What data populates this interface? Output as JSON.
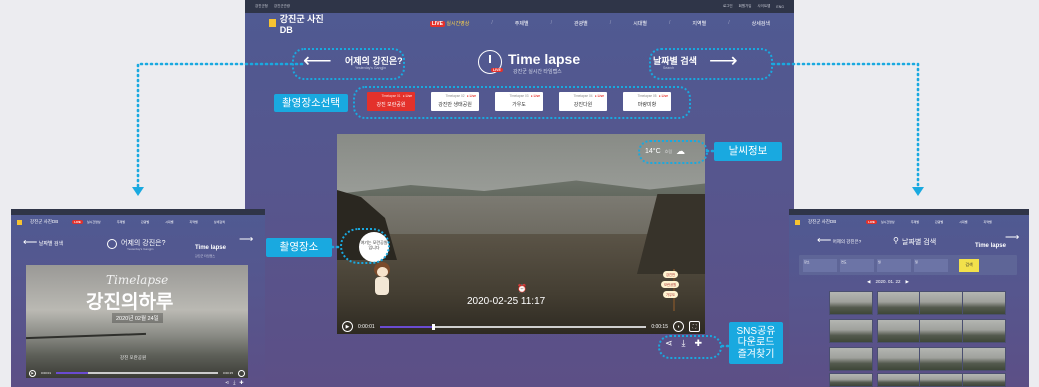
{
  "main": {
    "logo_text": "강진군 사진DB",
    "topbar_left": [
      "강진군청",
      "강진군관광"
    ],
    "topbar_right": [
      "로그인",
      "회원가입",
      "사이트맵",
      "ENG"
    ],
    "menu": [
      "LIVE",
      "실시간영상",
      "주제별",
      "관광별",
      "시대별",
      "지역별",
      "상세검색"
    ],
    "prev_label": "어제의 강진은?",
    "prev_sub": "Yesterday's Gangjin",
    "title": "Time lapse",
    "subtitle": "강진군 실시간 타임랩스",
    "next_label": "날짜별 검색",
    "next_sub": "Search",
    "locations": [
      {
        "top": "Timelapse 01",
        "live": "● Live",
        "name": "강진 모란공원",
        "active": true
      },
      {
        "top": "Timelapse 02",
        "live": "● Live",
        "name": "강진만 생태공원",
        "active": false
      },
      {
        "top": "Timelapse 03",
        "live": "● Live",
        "name": "가우도",
        "active": false
      },
      {
        "top": "Timelapse 04",
        "live": "● Live",
        "name": "강진다원",
        "active": false
      },
      {
        "top": "Timelapse 05",
        "live": "● Live",
        "name": "마량미항",
        "active": false
      }
    ],
    "weather_temp": "14°C",
    "weather_extra": "흐림",
    "timestamp": "2020-02-25 11:17",
    "time_start": "0:00:01",
    "time_end": "0:00:15",
    "progress": 0.2,
    "speech": "여기는 모란공원 입니다",
    "signs": [
      "강진만",
      "모란공원",
      "가우도"
    ]
  },
  "callouts": {
    "location_select": "촬영장소선택",
    "weather": "날씨정보",
    "location": "촬영장소",
    "sns": "SNS공유\n다운로드\n즐겨찾기"
  },
  "left": {
    "nav_search": "날짜별 검색",
    "title": "어제의 강진은?",
    "title_sub": "Yesterday's Gangjin",
    "right_title": "Time lapse",
    "right_sub": "강진군 타임랩스",
    "hero_script": "Timelapse",
    "hero_title": "강진의하루",
    "hero_date": "2020년 02월 24일",
    "hero_bottom": "강진 모란공원"
  },
  "right": {
    "nav_prev": "어제의 강진은?",
    "title": "날짜별 검색",
    "right_title": "Time lapse",
    "date_label": "2020. 01. 22",
    "search_btn": "검색",
    "filter_labels": [
      "장소",
      "연도",
      "월",
      "일"
    ]
  },
  "colors": {
    "accent": "#19a9e0",
    "live": "#e4312b",
    "logo": "#f6c331"
  }
}
